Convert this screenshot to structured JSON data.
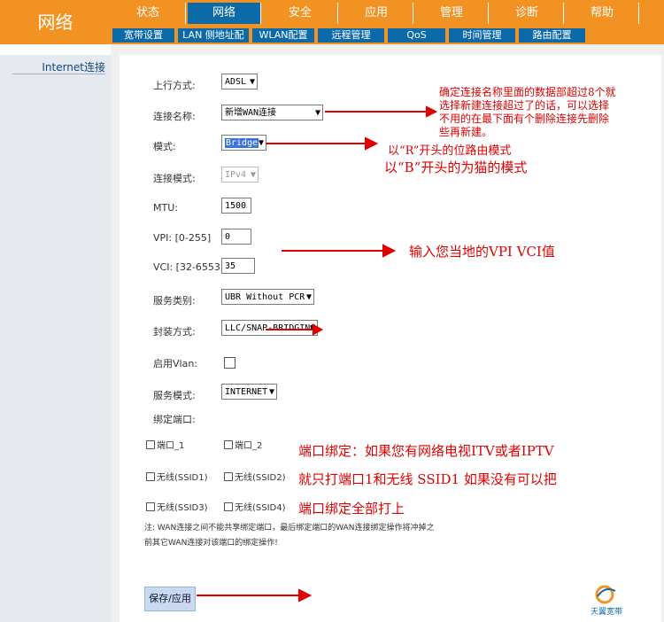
{
  "header": {
    "logo_text": "网络"
  },
  "main_nav": [
    "状态",
    "网络",
    "安全",
    "应用",
    "管理",
    "诊断",
    "帮助"
  ],
  "main_nav_active": "网络",
  "sub_nav": [
    "宽带设置",
    "LAN 侧地址配置",
    "WLAN配置",
    "远程管理",
    "QoS",
    "时间管理",
    "路由配置"
  ],
  "left_menu": {
    "label": "Internet连接"
  },
  "form": {
    "uplink_label": "上行方式:",
    "uplink_value": "ADSL",
    "conn_name_label": "连接名称:",
    "conn_name_value": "新增WAN连接",
    "mode_label": "模式:",
    "mode_value": "Bridge",
    "conn_mode_label": "连接模式:",
    "conn_mode_value": "IPv4",
    "mtu_label": "MTU:",
    "mtu_value": "1500",
    "vpi_label": "VPI: [0-255]",
    "vpi_value": "0",
    "vci_label": "VCI: [32-65535]",
    "vci_value": "35",
    "service_class_label": "服务类别:",
    "service_class_value": "UBR Without PCR",
    "encap_label": "封装方式:",
    "encap_value": "LLC/SNAP-BRIDGING",
    "vlan_label": "启用Vlan:",
    "service_mode_label": "服务模式:",
    "service_mode_value": "INTERNET",
    "bind_label": "绑定端口:",
    "ports": [
      "端口_1",
      "端口_2",
      "无线(SSID1)",
      "无线(SSID2)",
      "无线(SSID3)",
      "无线(SSID4)"
    ],
    "note_line1": "注: WAN连接之间不能共享绑定端口，最后绑定端口的WAN连接绑定操作将冲掉之",
    "note_line2": "前其它WAN连接对该端口的绑定操作!",
    "save_label": "保存/应用"
  },
  "annotations": {
    "a1_l1": "确定连接名称里面的数据部超过8个就",
    "a1_l2": "选择新建连接超过了的话，可以选择",
    "a1_l3": "不用的在最下面有个删除连接先删除",
    "a1_l4": "些再新建。",
    "a2": "以“R”开头的位路由模式",
    "a3": "以“B”开头的为猫的模式",
    "a4": "输入您当地的VPI VCI值",
    "a5_l1": "端口绑定：如果您有网络电视ITV或者IPTV",
    "a5_l2": "就只打端口1和无线 SSID1 如果没有可以把",
    "a5_l3": "端口绑定全部打上"
  },
  "brand_text": "天翼宽带",
  "colors": {
    "orange": "#f29223",
    "blue": "#0d6aa8",
    "annotation_red": "#e00000"
  }
}
